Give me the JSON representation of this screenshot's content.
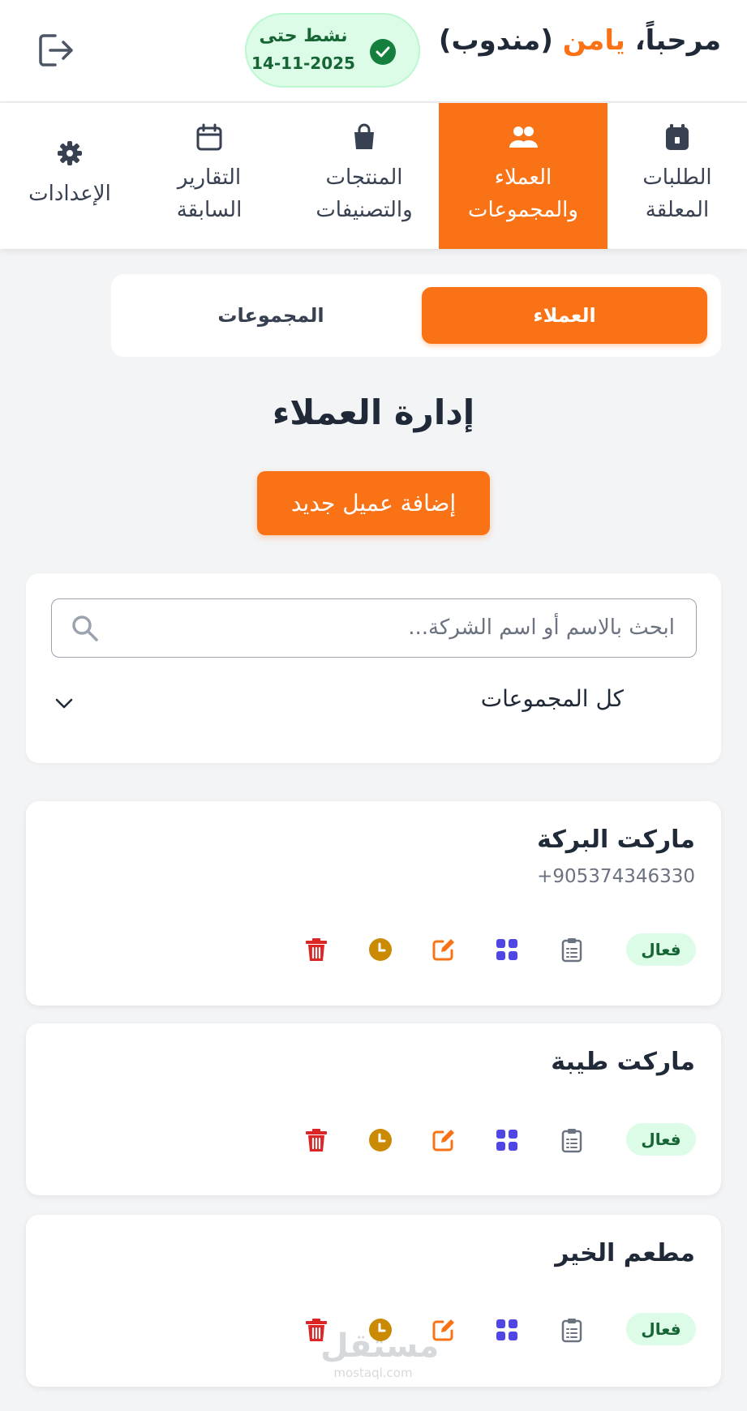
{
  "header": {
    "greeting_prefix": "مرحباً، ",
    "user_name": "يامن",
    "role": " (مندوب)",
    "status_label": "نشط حتى",
    "status_date": "14-11-2025",
    "logout_icon": "logout-icon"
  },
  "nav": {
    "items": [
      {
        "line1": "الطلبات",
        "line2": "المعلقة",
        "icon": "clipboard-icon",
        "active": false
      },
      {
        "line1": "العملاء",
        "line2": "والمجموعات",
        "icon": "users-icon",
        "active": true
      },
      {
        "line1": "المنتجات",
        "line2": "والتصنيفات",
        "icon": "shopping-bag-icon",
        "active": false
      },
      {
        "line1": "التقارير",
        "line2": "السابقة",
        "icon": "calendar-icon",
        "active": false
      },
      {
        "line1": "الإعدادات",
        "line2": "",
        "icon": "gear-icon",
        "active": false
      }
    ]
  },
  "segment": {
    "clients_label": "العملاء",
    "groups_label": "المجموعات"
  },
  "page": {
    "title": "إدارة العملاء",
    "add_button": "إضافة عميل جديد"
  },
  "filters": {
    "search_placeholder": "ابحث بالاسم أو اسم الشركة...",
    "group_selected": "كل المجموعات"
  },
  "clients": [
    {
      "name": "ماركت البركة",
      "phone": "+905374346330",
      "status": "فعال"
    },
    {
      "name": "ماركت طيبة",
      "phone": "",
      "status": "فعال"
    },
    {
      "name": "مطعم الخير",
      "phone": "",
      "status": "فعال"
    }
  ],
  "colors": {
    "accent": "#f97316",
    "active_green": "#15803d",
    "delete_red": "#dc2626",
    "history_amber": "#ca8a04",
    "grid_indigo": "#4f46e5"
  },
  "watermark": {
    "arabic": "مستقل",
    "latin": "mostaql.com"
  }
}
